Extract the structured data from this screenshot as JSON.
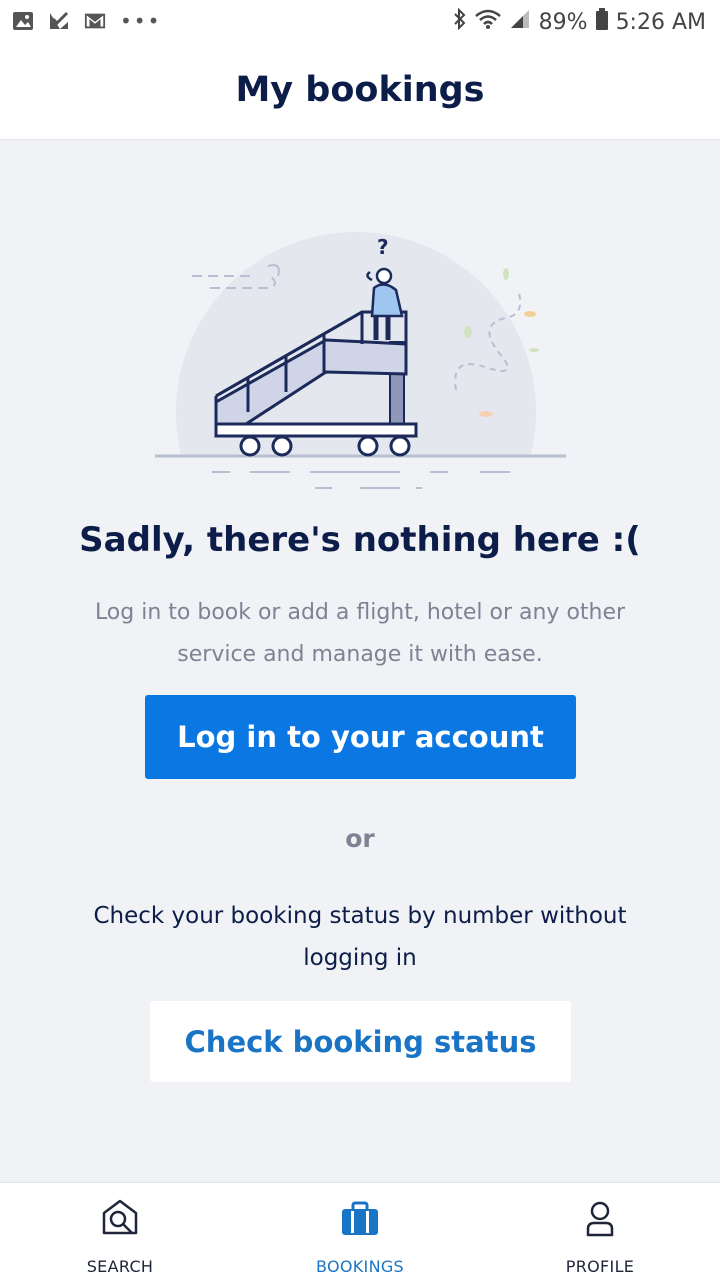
{
  "status_bar": {
    "battery": "89%",
    "time": "5:26 AM",
    "dots": "•••"
  },
  "header": {
    "title": "My bookings"
  },
  "empty_state": {
    "illustration_question_mark": "?",
    "title": "Sadly, there's nothing here :(",
    "description": "Log in to book or add a flight, hotel or any other service and manage it with ease."
  },
  "actions": {
    "login_label": "Log in to your account",
    "or_label": "or",
    "check_description": "Check your booking status by number without logging in",
    "check_label": "Check booking status"
  },
  "bottom_nav": {
    "items": [
      {
        "label": "SEARCH",
        "icon": "search-icon"
      },
      {
        "label": "BOOKINGS",
        "icon": "briefcase-icon"
      },
      {
        "label": "PROFILE",
        "icon": "profile-icon"
      }
    ]
  },
  "colors": {
    "primary": "#0b77e3",
    "accent_text": "#1a74c5",
    "title": "#0b1d48",
    "muted": "#7d8394",
    "background": "#f1f2f6"
  }
}
